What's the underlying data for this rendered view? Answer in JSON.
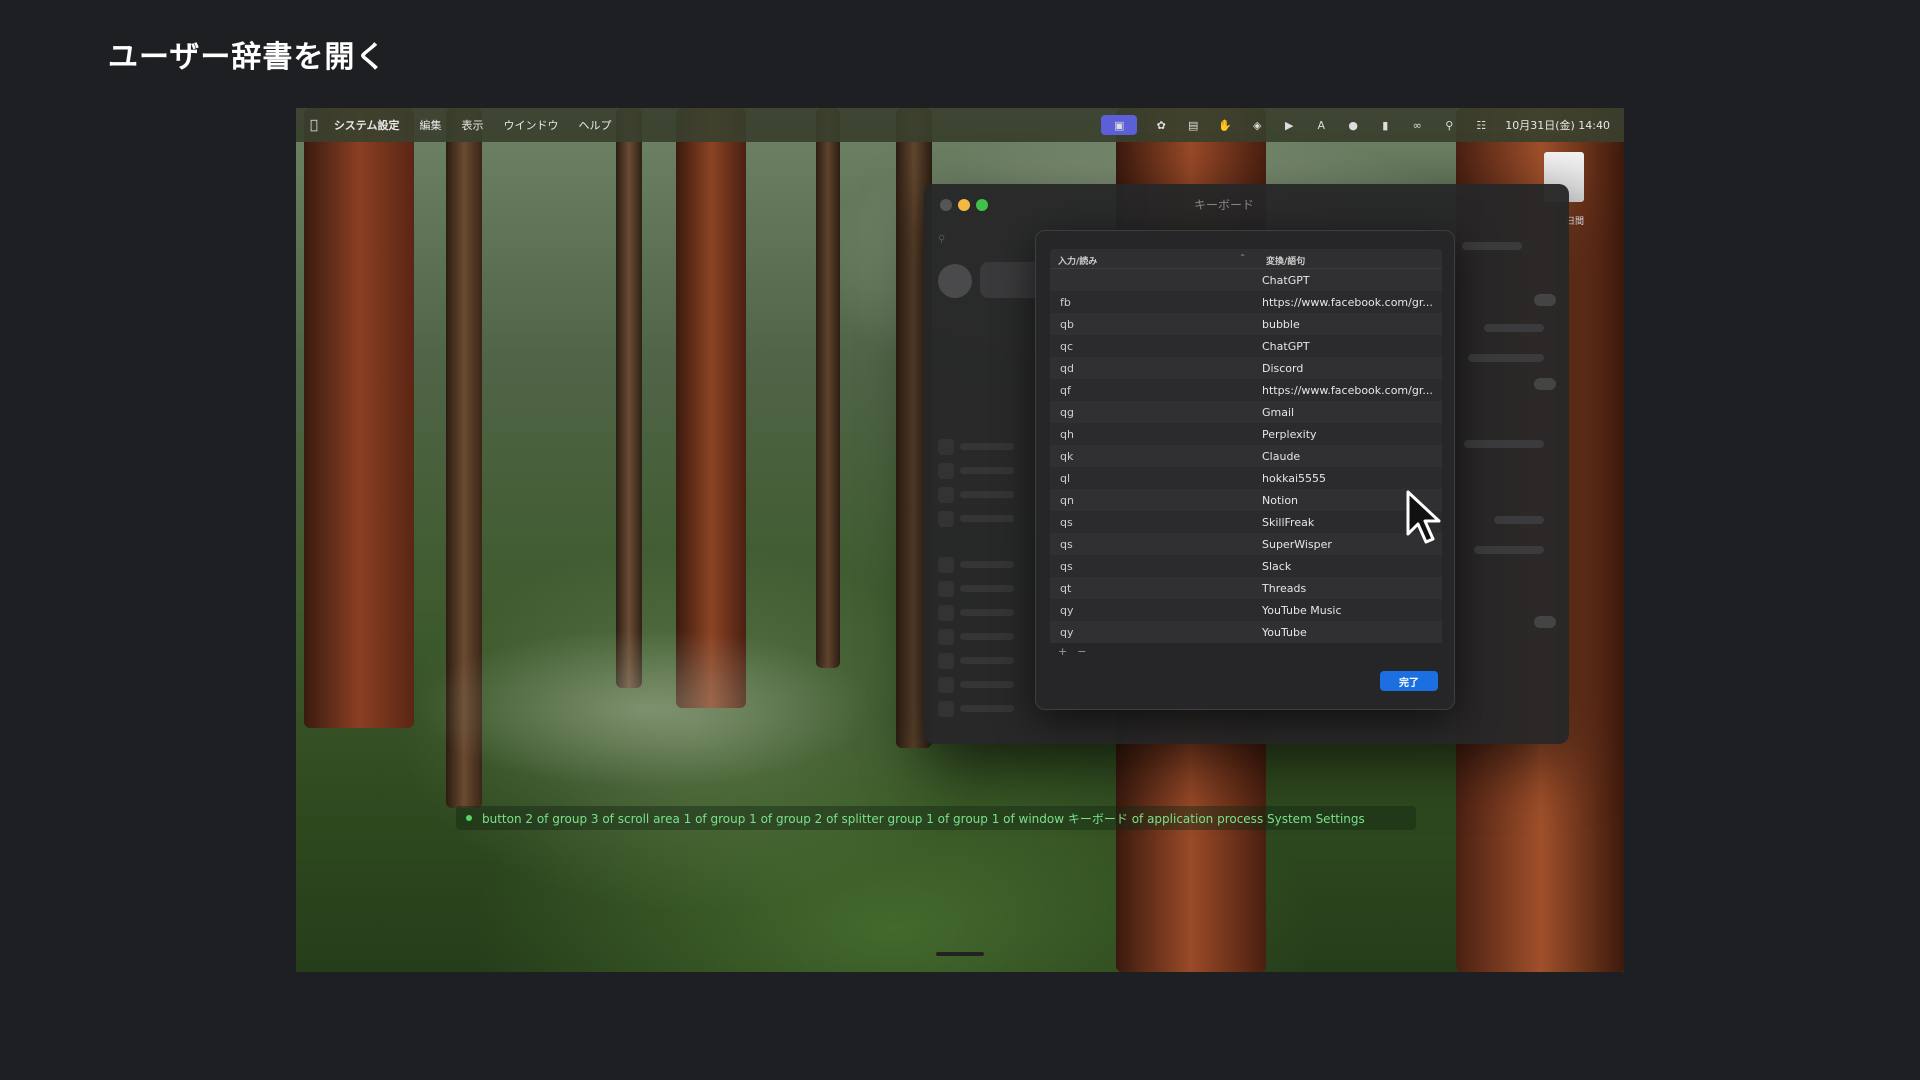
{
  "slide": {
    "title": "ユーザー辞書を開く"
  },
  "menubar": {
    "app_name": "システム設定",
    "menus": [
      "編集",
      "表示",
      "ウインドウ",
      "ヘルプ"
    ],
    "clock": "10月31日(金) 14:40",
    "status_icons": [
      "screen-share-icon",
      "chatgpt-icon",
      "clipboard-icon",
      "hand-icon",
      "layers-icon",
      "play-icon",
      "input-a-icon",
      "drop-icon",
      "battery-icon",
      "link-icon",
      "search-icon",
      "control-center-icon"
    ]
  },
  "desktop": {
    "file_label": "日間"
  },
  "window": {
    "title": "キーボード"
  },
  "dictionary": {
    "col_input": "入力/読み",
    "col_output": "変換/語句",
    "rows": [
      {
        "input": "",
        "output": "ChatGPT"
      },
      {
        "input": "fb",
        "output": "https://www.facebook.com/gr..."
      },
      {
        "input": "qb",
        "output": "bubble"
      },
      {
        "input": "qc",
        "output": "ChatGPT"
      },
      {
        "input": "qd",
        "output": "Discord"
      },
      {
        "input": "qf",
        "output": "https://www.facebook.com/gr..."
      },
      {
        "input": "qg",
        "output": "Gmail"
      },
      {
        "input": "qh",
        "output": "Perplexity"
      },
      {
        "input": "qk",
        "output": "Claude"
      },
      {
        "input": "ql",
        "output": "hokkai5555"
      },
      {
        "input": "qn",
        "output": "Notion"
      },
      {
        "input": "qs",
        "output": "SkillFreak"
      },
      {
        "input": "qs",
        "output": "SuperWisper"
      },
      {
        "input": "qs",
        "output": "Slack"
      },
      {
        "input": "qt",
        "output": "Threads"
      },
      {
        "input": "qy",
        "output": "YouTube Music"
      },
      {
        "input": "qy",
        "output": "YouTube"
      }
    ],
    "add": "+",
    "remove": "−",
    "done_label": "完了"
  },
  "caption": "button 2 of group 3 of scroll area 1 of group 1 of group 2 of splitter group 1 of group 1 of window キーボード of application process System Settings"
}
